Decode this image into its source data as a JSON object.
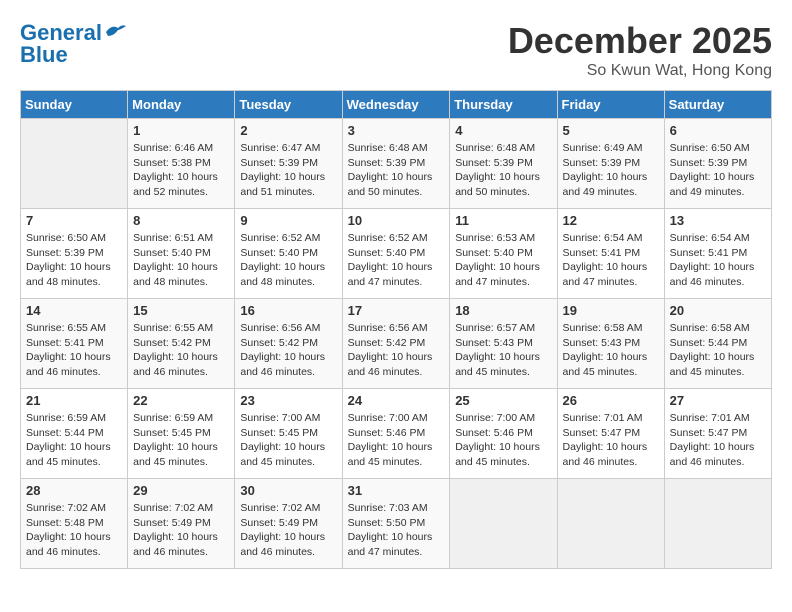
{
  "header": {
    "logo_line1": "General",
    "logo_line2": "Blue",
    "month": "December 2025",
    "location": "So Kwun Wat, Hong Kong"
  },
  "days_of_week": [
    "Sunday",
    "Monday",
    "Tuesday",
    "Wednesday",
    "Thursday",
    "Friday",
    "Saturday"
  ],
  "weeks": [
    [
      {
        "num": "",
        "info": ""
      },
      {
        "num": "1",
        "info": "Sunrise: 6:46 AM\nSunset: 5:38 PM\nDaylight: 10 hours\nand 52 minutes."
      },
      {
        "num": "2",
        "info": "Sunrise: 6:47 AM\nSunset: 5:39 PM\nDaylight: 10 hours\nand 51 minutes."
      },
      {
        "num": "3",
        "info": "Sunrise: 6:48 AM\nSunset: 5:39 PM\nDaylight: 10 hours\nand 50 minutes."
      },
      {
        "num": "4",
        "info": "Sunrise: 6:48 AM\nSunset: 5:39 PM\nDaylight: 10 hours\nand 50 minutes."
      },
      {
        "num": "5",
        "info": "Sunrise: 6:49 AM\nSunset: 5:39 PM\nDaylight: 10 hours\nand 49 minutes."
      },
      {
        "num": "6",
        "info": "Sunrise: 6:50 AM\nSunset: 5:39 PM\nDaylight: 10 hours\nand 49 minutes."
      }
    ],
    [
      {
        "num": "7",
        "info": "Sunrise: 6:50 AM\nSunset: 5:39 PM\nDaylight: 10 hours\nand 48 minutes."
      },
      {
        "num": "8",
        "info": "Sunrise: 6:51 AM\nSunset: 5:40 PM\nDaylight: 10 hours\nand 48 minutes."
      },
      {
        "num": "9",
        "info": "Sunrise: 6:52 AM\nSunset: 5:40 PM\nDaylight: 10 hours\nand 48 minutes."
      },
      {
        "num": "10",
        "info": "Sunrise: 6:52 AM\nSunset: 5:40 PM\nDaylight: 10 hours\nand 47 minutes."
      },
      {
        "num": "11",
        "info": "Sunrise: 6:53 AM\nSunset: 5:40 PM\nDaylight: 10 hours\nand 47 minutes."
      },
      {
        "num": "12",
        "info": "Sunrise: 6:54 AM\nSunset: 5:41 PM\nDaylight: 10 hours\nand 47 minutes."
      },
      {
        "num": "13",
        "info": "Sunrise: 6:54 AM\nSunset: 5:41 PM\nDaylight: 10 hours\nand 46 minutes."
      }
    ],
    [
      {
        "num": "14",
        "info": "Sunrise: 6:55 AM\nSunset: 5:41 PM\nDaylight: 10 hours\nand 46 minutes."
      },
      {
        "num": "15",
        "info": "Sunrise: 6:55 AM\nSunset: 5:42 PM\nDaylight: 10 hours\nand 46 minutes."
      },
      {
        "num": "16",
        "info": "Sunrise: 6:56 AM\nSunset: 5:42 PM\nDaylight: 10 hours\nand 46 minutes."
      },
      {
        "num": "17",
        "info": "Sunrise: 6:56 AM\nSunset: 5:42 PM\nDaylight: 10 hours\nand 46 minutes."
      },
      {
        "num": "18",
        "info": "Sunrise: 6:57 AM\nSunset: 5:43 PM\nDaylight: 10 hours\nand 45 minutes."
      },
      {
        "num": "19",
        "info": "Sunrise: 6:58 AM\nSunset: 5:43 PM\nDaylight: 10 hours\nand 45 minutes."
      },
      {
        "num": "20",
        "info": "Sunrise: 6:58 AM\nSunset: 5:44 PM\nDaylight: 10 hours\nand 45 minutes."
      }
    ],
    [
      {
        "num": "21",
        "info": "Sunrise: 6:59 AM\nSunset: 5:44 PM\nDaylight: 10 hours\nand 45 minutes."
      },
      {
        "num": "22",
        "info": "Sunrise: 6:59 AM\nSunset: 5:45 PM\nDaylight: 10 hours\nand 45 minutes."
      },
      {
        "num": "23",
        "info": "Sunrise: 7:00 AM\nSunset: 5:45 PM\nDaylight: 10 hours\nand 45 minutes."
      },
      {
        "num": "24",
        "info": "Sunrise: 7:00 AM\nSunset: 5:46 PM\nDaylight: 10 hours\nand 45 minutes."
      },
      {
        "num": "25",
        "info": "Sunrise: 7:00 AM\nSunset: 5:46 PM\nDaylight: 10 hours\nand 45 minutes."
      },
      {
        "num": "26",
        "info": "Sunrise: 7:01 AM\nSunset: 5:47 PM\nDaylight: 10 hours\nand 46 minutes."
      },
      {
        "num": "27",
        "info": "Sunrise: 7:01 AM\nSunset: 5:47 PM\nDaylight: 10 hours\nand 46 minutes."
      }
    ],
    [
      {
        "num": "28",
        "info": "Sunrise: 7:02 AM\nSunset: 5:48 PM\nDaylight: 10 hours\nand 46 minutes."
      },
      {
        "num": "29",
        "info": "Sunrise: 7:02 AM\nSunset: 5:49 PM\nDaylight: 10 hours\nand 46 minutes."
      },
      {
        "num": "30",
        "info": "Sunrise: 7:02 AM\nSunset: 5:49 PM\nDaylight: 10 hours\nand 46 minutes."
      },
      {
        "num": "31",
        "info": "Sunrise: 7:03 AM\nSunset: 5:50 PM\nDaylight: 10 hours\nand 47 minutes."
      },
      {
        "num": "",
        "info": ""
      },
      {
        "num": "",
        "info": ""
      },
      {
        "num": "",
        "info": ""
      }
    ]
  ]
}
